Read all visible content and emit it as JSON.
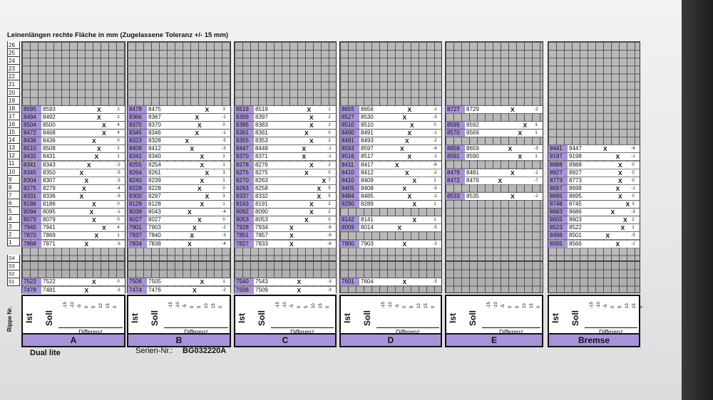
{
  "title": "Leinenlängen rechte Fläche in mm (Zugelassene Toleranz +/- 15 mm)",
  "row_labels": [
    "26",
    "25",
    "24",
    "23",
    "22",
    "21",
    "20",
    "19",
    "18",
    "17",
    "16",
    "15",
    "14",
    "13",
    "12",
    "11",
    "10",
    "9",
    "8",
    "7",
    "6",
    "5",
    "4",
    "3",
    "2",
    "1"
  ],
  "s_labels": [
    "S4",
    "S3",
    "S2",
    "S1"
  ],
  "header": {
    "rippe": "Rippe Nr.",
    "ist": "Ist",
    "soll": "Soll",
    "differenz": "Differenz",
    "scale": [
      "-15",
      "-10",
      "-5",
      "0",
      "5",
      "10",
      "15",
      "0"
    ]
  },
  "groups": [
    {
      "label": "A",
      "rows": [
        [
          "18",
          "8595",
          "8593",
          "2"
        ],
        [
          "17",
          "8494",
          "8492",
          "2"
        ],
        [
          "16",
          "8504",
          "8500",
          "4"
        ],
        [
          "15",
          "8472",
          "8468",
          "4"
        ],
        [
          "14",
          "8436",
          "8436",
          "0"
        ],
        [
          "13",
          "8510",
          "8508",
          "2"
        ],
        [
          "12",
          "8432",
          "8431",
          "1"
        ],
        [
          "11",
          "8341",
          "8343",
          "-2"
        ],
        [
          "10",
          "8345",
          "8350",
          "-5"
        ],
        [
          "9",
          "8304",
          "8307",
          "-3"
        ],
        [
          "8",
          "8275",
          "8279",
          "-4"
        ],
        [
          "7",
          "8331",
          "8336",
          "-5"
        ],
        [
          "6",
          "8186",
          "8186",
          "0"
        ],
        [
          "5",
          "8094",
          "8095",
          "-1"
        ],
        [
          "4",
          "8079",
          "8079",
          "0"
        ],
        [
          "3",
          "7945",
          "7941",
          "4"
        ],
        [
          "2",
          "7870",
          "7869",
          "1"
        ],
        [
          "1",
          "7868",
          "7871",
          "-3"
        ]
      ],
      "srows": [
        [
          "S2",
          "7522",
          "7522",
          "0"
        ],
        [
          "S1",
          "7478",
          "7481",
          "-3"
        ]
      ]
    },
    {
      "label": "B",
      "rows": [
        [
          "18",
          "8478",
          "8475",
          "3"
        ],
        [
          "17",
          "8366",
          "8367",
          "-1"
        ],
        [
          "16",
          "8370",
          "8370",
          "0"
        ],
        [
          "15",
          "8345",
          "8346",
          "-1"
        ],
        [
          "14",
          "8323",
          "8328",
          "-5"
        ],
        [
          "13",
          "8409",
          "8412",
          "-3"
        ],
        [
          "12",
          "8341",
          "8340",
          "1"
        ],
        [
          "11",
          "8255",
          "8254",
          "1"
        ],
        [
          "10",
          "8264",
          "8261",
          "3"
        ],
        [
          "9",
          "8240",
          "8239",
          "1"
        ],
        [
          "8",
          "8228",
          "8228",
          "0"
        ],
        [
          "7",
          "8300",
          "8297",
          "3"
        ],
        [
          "6",
          "8129",
          "8128",
          "1"
        ],
        [
          "5",
          "8039",
          "8043",
          "-4"
        ],
        [
          "4",
          "8027",
          "8027",
          "0"
        ],
        [
          "3",
          "7901",
          "7903",
          "-2"
        ],
        [
          "2",
          "7837",
          "7840",
          "-3"
        ],
        [
          "1",
          "7834",
          "7838",
          "-4"
        ]
      ],
      "srows": [
        [
          "S2",
          "7506",
          "7505",
          "1"
        ],
        [
          "S1",
          "7474",
          "7476",
          "-2"
        ]
      ]
    },
    {
      "label": "C",
      "rows": [
        [
          "18",
          "8519",
          "8518",
          "1"
        ],
        [
          "17",
          "8399",
          "8397",
          "2"
        ],
        [
          "16",
          "8385",
          "8383",
          "2"
        ],
        [
          "15",
          "8361",
          "8361",
          "0"
        ],
        [
          "14",
          "8355",
          "8353",
          "2"
        ],
        [
          "13",
          "8447",
          "8448",
          "-1"
        ],
        [
          "12",
          "8370",
          "8371",
          "-1"
        ],
        [
          "11",
          "8278",
          "8276",
          "2"
        ],
        [
          "10",
          "8275",
          "8275",
          "0"
        ],
        [
          "9",
          "8270",
          "8263",
          "7"
        ],
        [
          "8",
          "8263",
          "8258",
          "5"
        ],
        [
          "7",
          "8337",
          "8332",
          "5"
        ],
        [
          "6",
          "8193",
          "8191",
          "2"
        ],
        [
          "5",
          "8092",
          "8090",
          "2"
        ],
        [
          "4",
          "8053",
          "8053",
          "0"
        ],
        [
          "3",
          "7928",
          "7934",
          "-6"
        ],
        [
          "2",
          "7851",
          "7857",
          "-6"
        ],
        [
          "1",
          "7827",
          "7833",
          "-6"
        ]
      ],
      "srows": [
        [
          "S2",
          "7540",
          "7543",
          "-3"
        ],
        [
          "S1",
          "7506",
          "7509",
          "-3"
        ]
      ]
    },
    {
      "label": "D",
      "rows": [
        [
          "18",
          "8655",
          "8656",
          "-1"
        ],
        [
          "17",
          "8527",
          "8530",
          "-3"
        ],
        [
          "16",
          "8510",
          "8510",
          "0"
        ],
        [
          "15",
          "8490",
          "8491",
          "-1"
        ],
        [
          "14",
          "8491",
          "8493",
          "-2"
        ],
        [
          "13",
          "8593",
          "8597",
          "-4"
        ],
        [
          "12",
          "8516",
          "8517",
          "-1"
        ],
        [
          "11",
          "8411",
          "8417",
          "-6"
        ],
        [
          "10",
          "8410",
          "8412",
          "-2"
        ],
        [
          "9",
          "8410",
          "8409",
          "1"
        ],
        [
          "8",
          "8405",
          "8408",
          "-3"
        ],
        [
          "7",
          "8484",
          "8485",
          "-1"
        ],
        [
          "6",
          "8290",
          "8289",
          "1"
        ],
        [
          "5",
          "",
          "",
          " "
        ],
        [
          "4",
          "8142",
          "8141",
          "1"
        ],
        [
          "3",
          "8009",
          "8014",
          "-5"
        ],
        [
          "2",
          "",
          "",
          ""
        ],
        [
          "1",
          "7900",
          "7903",
          "-3"
        ]
      ],
      "srows": [
        [
          "S2",
          "7601",
          "7604",
          "-3"
        ],
        [
          "S1",
          "",
          "",
          ""
        ]
      ]
    },
    {
      "label": "E",
      "rows": [
        [
          "18",
          "8727",
          "8729",
          "-2"
        ],
        [
          "17",
          "",
          "",
          ""
        ],
        [
          "16",
          "8595",
          "8592",
          "3"
        ],
        [
          "15",
          "8570",
          "8569",
          "1"
        ],
        [
          "14",
          "",
          "",
          ""
        ],
        [
          "13",
          "8656",
          "8659",
          "-3"
        ],
        [
          "12",
          "8591",
          "8590",
          "1"
        ],
        [
          "11",
          "",
          "",
          ""
        ],
        [
          "10",
          "8479",
          "8481",
          "-2"
        ],
        [
          "9",
          "8472",
          "8479",
          "-7"
        ],
        [
          "8",
          "",
          "",
          ""
        ],
        [
          "7",
          "8533",
          "8535",
          "-2"
        ],
        [
          "6",
          "",
          "",
          ""
        ],
        [
          "5",
          "",
          "",
          ""
        ],
        [
          "4",
          "",
          "",
          ""
        ],
        [
          "3",
          "",
          "",
          ""
        ],
        [
          "2",
          "",
          "",
          ""
        ],
        [
          "1",
          "",
          "",
          ""
        ]
      ],
      "srows": []
    },
    {
      "label": "Bremse",
      "rows": [
        [
          "18",
          "",
          "",
          ""
        ],
        [
          "17",
          "",
          "",
          ""
        ],
        [
          "16",
          "",
          "",
          ""
        ],
        [
          "15",
          "",
          "",
          ""
        ],
        [
          "14",
          "",
          "",
          ""
        ],
        [
          "13",
          "9441",
          "9447",
          "-6"
        ],
        [
          "12",
          "9197",
          "9198",
          "-1"
        ],
        [
          "11",
          "8988",
          "8988",
          "0"
        ],
        [
          "10",
          "8927",
          "8927",
          "0"
        ],
        [
          "9",
          "8773",
          "8773",
          "0"
        ],
        [
          "8",
          "8697",
          "8698",
          "-1"
        ],
        [
          "7",
          "8695",
          "8695",
          "0"
        ],
        [
          "6",
          "8748",
          "8745",
          "3"
        ],
        [
          "5",
          "8683",
          "8686",
          "-3"
        ],
        [
          "4",
          "8605",
          "8603",
          "2"
        ],
        [
          "3",
          "8523",
          "8522",
          "1"
        ],
        [
          "2",
          "8496",
          "8501",
          "-5"
        ],
        [
          "1",
          "8565",
          "8566",
          "-1"
        ]
      ],
      "srows": []
    }
  ],
  "footer": {
    "model": "Dual lite",
    "serial_label": "Serien-Nr.:",
    "serial": "BG032220A"
  },
  "colors": {
    "ist": "#a893d8",
    "grid": "#b9b9bb"
  }
}
